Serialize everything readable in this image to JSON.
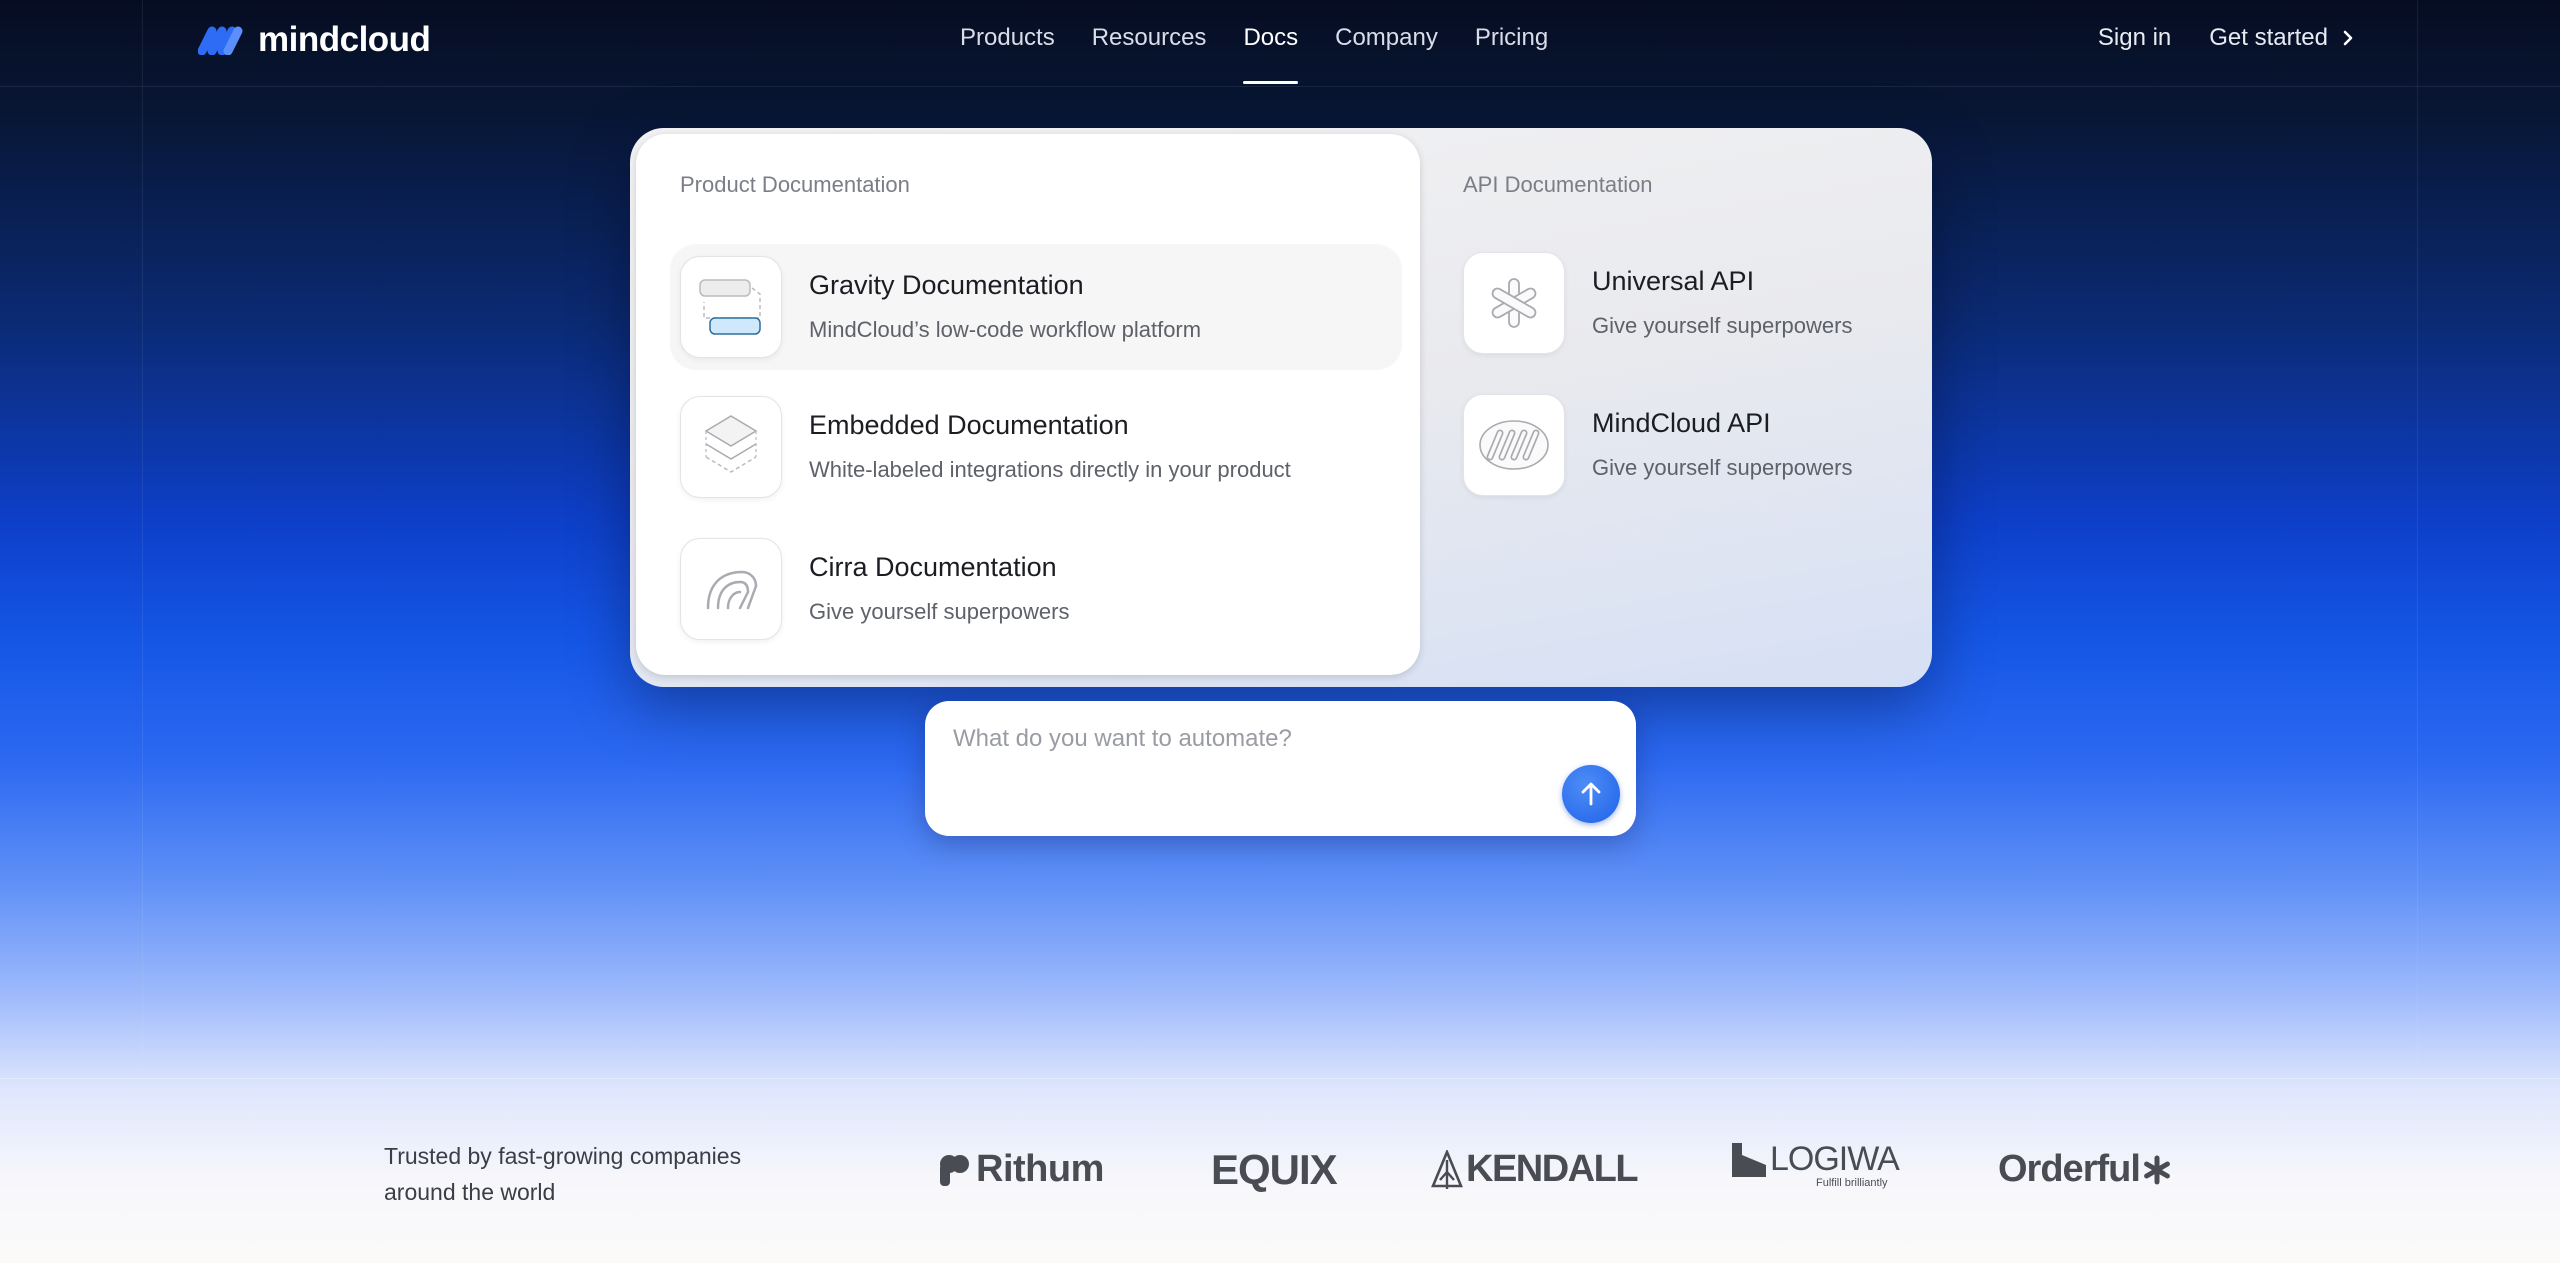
{
  "nav": {
    "brand": "mindcloud",
    "links": [
      "Products",
      "Resources",
      "Docs",
      "Company",
      "Pricing"
    ],
    "active": "Docs",
    "sign_in": "Sign in",
    "get_started": "Get started"
  },
  "menu": {
    "product_heading": "Product Documentation",
    "api_heading": "API Documentation",
    "product_items": [
      {
        "title": "Gravity Documentation",
        "desc": "MindCloud’s low-code workflow platform",
        "icon": "workflow-icon"
      },
      {
        "title": "Embedded Documentation",
        "desc": "White-labeled integrations directly in your product",
        "icon": "layers-icon"
      },
      {
        "title": "Cirra Documentation",
        "desc": "Give yourself superpowers",
        "icon": "cirra-icon"
      }
    ],
    "api_items": [
      {
        "title": "Universal API",
        "desc": "Give yourself superpowers",
        "icon": "asterisk-icon"
      },
      {
        "title": "MindCloud API",
        "desc": "Give yourself superpowers",
        "icon": "mindcloud-logo-icon"
      }
    ]
  },
  "prompt": {
    "placeholder": "What do you want to automate?"
  },
  "trusted": {
    "text": "Trusted by fast-growing companies around the world",
    "logos": [
      "Rithum",
      "EQUIX",
      "KENDALL",
      "LOGIWA",
      "Orderful"
    ],
    "logiwa_tagline": "Fulfill brilliantly"
  },
  "colors": {
    "accent": "#1f63e8",
    "highlight": "#cfe8fb"
  }
}
